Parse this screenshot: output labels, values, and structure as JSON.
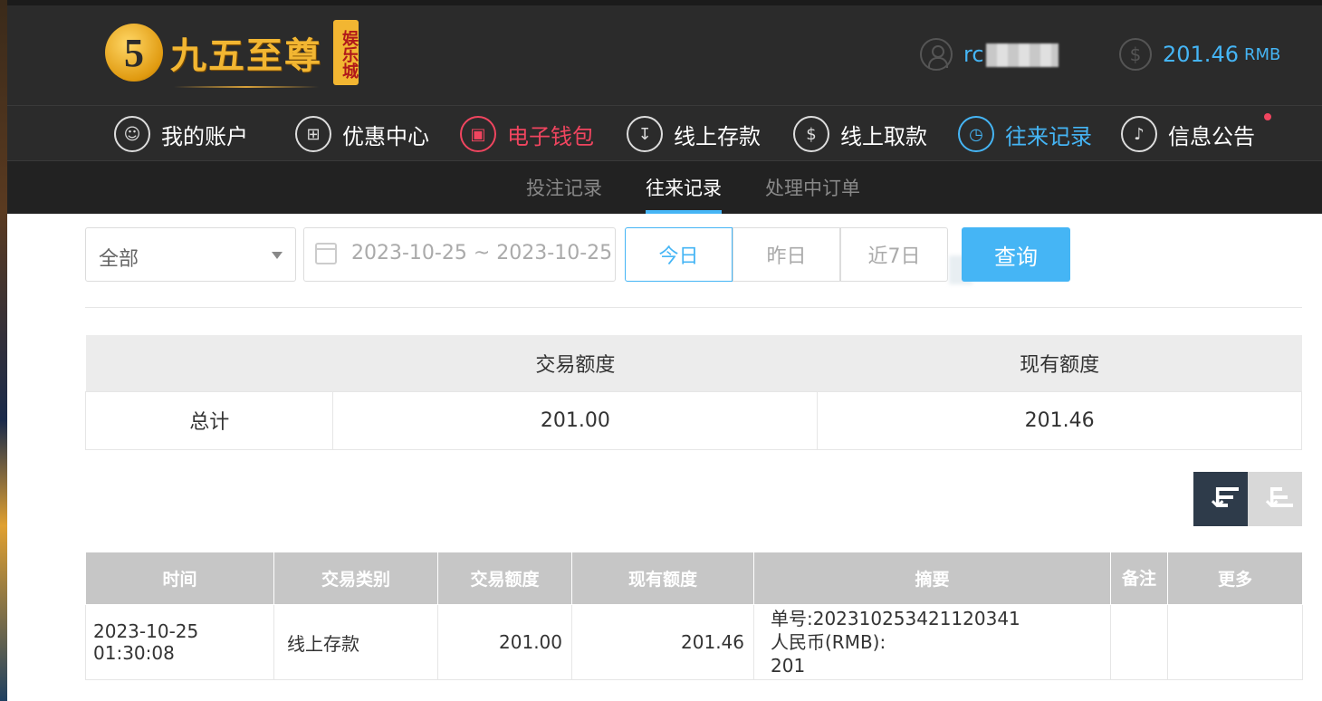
{
  "brand": {
    "logo_mark": "5",
    "name": "九五至尊",
    "badge": "娱乐城"
  },
  "account": {
    "username_prefix": "rc",
    "balance": "201.46",
    "currency": "RMB"
  },
  "main_nav": [
    {
      "label": "我的账户",
      "icon": "user-icon"
    },
    {
      "label": "优惠中心",
      "icon": "gift-icon"
    },
    {
      "label": "电子钱包",
      "icon": "wallet-icon"
    },
    {
      "label": "线上存款",
      "icon": "deposit-icon"
    },
    {
      "label": "线上取款",
      "icon": "withdraw-icon"
    },
    {
      "label": "往来记录",
      "icon": "records-icon"
    },
    {
      "label": "信息公告",
      "icon": "bell-icon"
    }
  ],
  "sub_nav": [
    "投注记录",
    "往来记录",
    "处理中订单"
  ],
  "filters": {
    "type_select": "全部",
    "date_range": "2023-10-25 ~ 2023-10-25",
    "quick": [
      "今日",
      "昨日",
      "近7日"
    ],
    "query_label": "查询"
  },
  "summary": {
    "headers": [
      "",
      "交易额度",
      "现有额度"
    ],
    "row": [
      "总计",
      "201.00",
      "201.46"
    ]
  },
  "records": {
    "headers": [
      "时间",
      "交易类别",
      "交易额度",
      "现有额度",
      "摘要",
      "备注",
      "更多"
    ],
    "rows": [
      {
        "time": "2023-10-25 01:30:08",
        "type": "线上存款",
        "amount": "201.00",
        "balance": "201.46",
        "summary_line1": "单号:202310253421120341",
        "summary_line2": "人民币(RMB):",
        "summary_line3": "201",
        "note": "",
        "more": ""
      }
    ]
  },
  "colors": {
    "accent_blue": "#45b5f5",
    "accent_red": "#f0455f",
    "header_bg": "#2b2b2b",
    "logo_gold": "#f2b632"
  }
}
